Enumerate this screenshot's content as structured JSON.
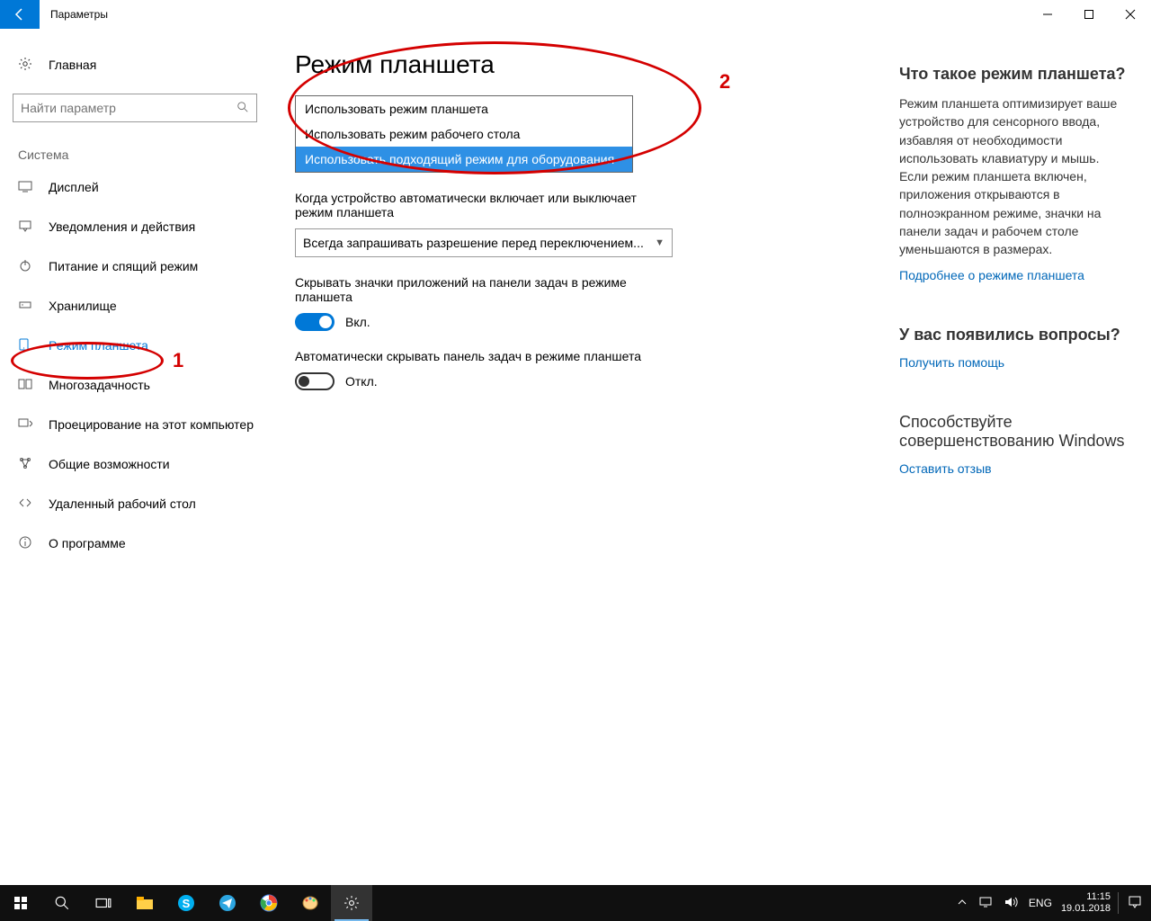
{
  "titlebar": {
    "title": "Параметры"
  },
  "sidebar": {
    "home": "Главная",
    "search_placeholder": "Найти параметр",
    "group": "Система",
    "items": [
      {
        "label": "Дисплей"
      },
      {
        "label": "Уведомления и действия"
      },
      {
        "label": "Питание и спящий режим"
      },
      {
        "label": "Хранилище"
      },
      {
        "label": "Режим планшета"
      },
      {
        "label": "Многозадачность"
      },
      {
        "label": "Проецирование на этот компьютер"
      },
      {
        "label": "Общие возможности"
      },
      {
        "label": "Удаленный рабочий стол"
      },
      {
        "label": "О программе"
      }
    ]
  },
  "main": {
    "title": "Режим планшета",
    "dropdown1": {
      "opts": [
        "Использовать режим планшета",
        "Использовать режим рабочего стола",
        "Использовать подходящий режим для оборудования"
      ]
    },
    "label2": "Когда устройство автоматически включает или выключает режим планшета",
    "select2": "Всегда запрашивать разрешение перед переключением...",
    "label3": "Скрывать значки приложений на панели задач в режиме планшета",
    "toggle3": "Вкл.",
    "label4": "Автоматически скрывать панель задач в режиме планшета",
    "toggle4": "Откл."
  },
  "right": {
    "h1": "Что такое режим планшета?",
    "p1": "Режим планшета оптимизирует ваше устройство для сенсорного ввода, избавляя от необходимости использовать клавиатуру и мышь. Если режим планшета включен, приложения открываются в полноэкранном режиме, значки на панели задач и рабочем столе уменьшаются в размерах.",
    "link1": "Подробнее о режиме планшета",
    "h2": "У вас появились вопросы?",
    "link2": "Получить помощь",
    "h3": "Способствуйте совершенствованию Windows",
    "link3": "Оставить отзыв"
  },
  "annotations": {
    "n1": "1",
    "n2": "2"
  },
  "taskbar": {
    "lang": "ENG",
    "time": "11:15",
    "date": "19.01.2018"
  }
}
